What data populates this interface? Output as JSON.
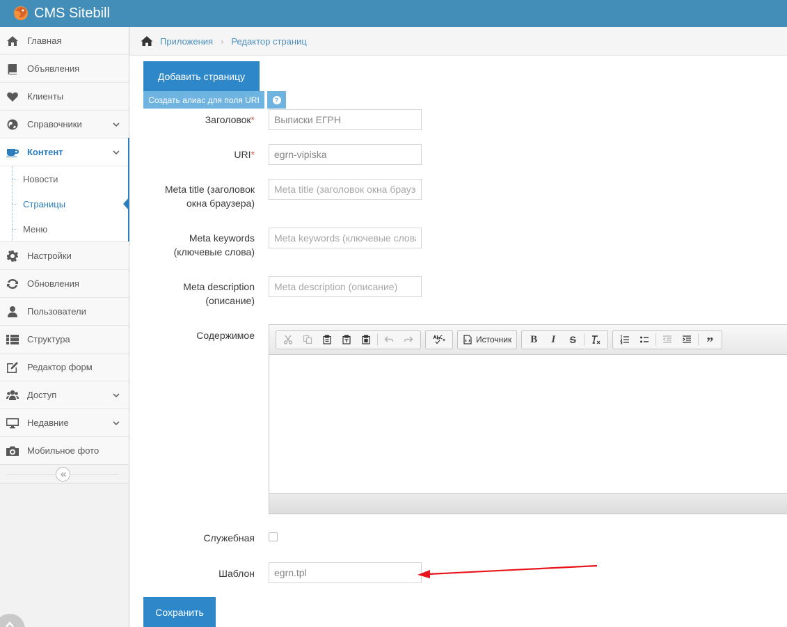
{
  "app": {
    "title": "CMS Sitebill"
  },
  "sidebar": {
    "items": [
      {
        "label": "Главная",
        "icon": "home-icon"
      },
      {
        "label": "Объявления",
        "icon": "book-icon"
      },
      {
        "label": "Клиенты",
        "icon": "heart-icon"
      },
      {
        "label": "Справочники",
        "icon": "globe-icon",
        "expandable": true
      },
      {
        "label": "Контент",
        "icon": "coffee-icon",
        "expandable": true,
        "active": true
      },
      {
        "label": "Настройки",
        "icon": "cog-icon"
      },
      {
        "label": "Обновления",
        "icon": "refresh-icon"
      },
      {
        "label": "Пользователи",
        "icon": "user-icon"
      },
      {
        "label": "Структура",
        "icon": "list-icon"
      },
      {
        "label": "Редактор форм",
        "icon": "edit-icon"
      },
      {
        "label": "Доступ",
        "icon": "users-icon",
        "expandable": true
      },
      {
        "label": "Недавние",
        "icon": "desktop-icon",
        "expandable": true
      },
      {
        "label": "Мобильное фото",
        "icon": "camera-icon"
      }
    ],
    "content_submenu": [
      {
        "label": "Новости"
      },
      {
        "label": "Страницы",
        "active": true
      },
      {
        "label": "Меню"
      }
    ]
  },
  "breadcrumb": {
    "items": [
      "Приложения",
      "Редактор страниц"
    ]
  },
  "actions": {
    "add_page": "Добавить страницу",
    "create_alias": "Создать алиас для поля URI",
    "help": "?",
    "save": "Сохранить"
  },
  "form": {
    "title": {
      "label": "Заголовок",
      "required_mark": "*",
      "value": "Выписки ЕГРН"
    },
    "uri": {
      "label": "URI",
      "required_mark": "*",
      "value": "egrn-vipiska"
    },
    "meta_title": {
      "label_line1": "Meta title (заголовок",
      "label_line2": "окна браузера)",
      "placeholder": "Meta title (заголовок окна браузера)"
    },
    "meta_keywords": {
      "label_line1": "Meta keywords",
      "label_line2": "(ключевые слова)",
      "placeholder": "Meta keywords (ключевые слова)"
    },
    "meta_description": {
      "label_line1": "Meta description",
      "label_line2": "(описание)",
      "placeholder": "Meta description (описание)"
    },
    "content": {
      "label": "Содержимое",
      "source_button": "Источник"
    },
    "service": {
      "label": "Служебная",
      "checked": false
    },
    "template": {
      "label": "Шаблон",
      "value": "egrn.tpl"
    }
  },
  "colors": {
    "navbar": "#438eb9",
    "accent": "#2e87c8",
    "arrow": "#e8141b"
  }
}
